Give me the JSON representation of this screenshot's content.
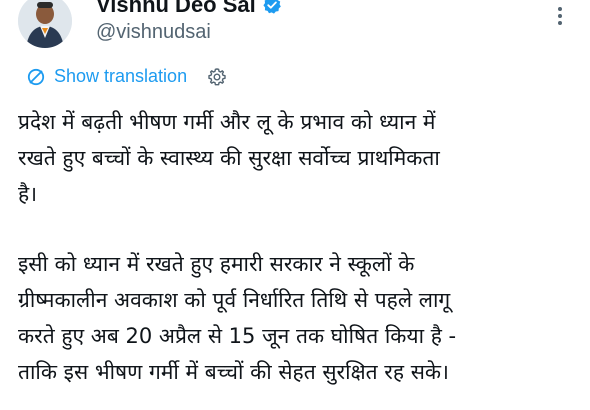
{
  "author": {
    "display_name": "Vishnu Deo Sai",
    "handle": "@vishnudsai",
    "verified": true,
    "avatar_icon": "profile-photo"
  },
  "actions": {
    "more_icon": "vertical-dots-icon"
  },
  "translation": {
    "link_label": "Show translation",
    "icon": "translate-icon",
    "settings_icon": "gear-icon"
  },
  "tweet": {
    "paragraph_1": "प्रदेश में बढ़ती भीषण गर्मी और लू के प्रभाव को ध्यान में\nरखते हुए बच्चों के स्वास्थ्य की सुरक्षा सर्वोच्च प्राथमिकता\nहै।",
    "paragraph_2": "इसी को ध्यान में रखते हुए हमारी सरकार ने स्कूलों के\nग्रीष्मकालीन अवकाश को पूर्व निर्धारित तिथि से पहले लागू\nकरते हुए अब 20 अप्रैल से 15 जून तक घोषित किया है -\nताकि इस भीषण गर्मी में बच्चों की सेहत सुरक्षित रह सके।"
  },
  "colors": {
    "link": "#1d9bf0",
    "secondary_text": "#536471",
    "primary_text": "#0f1419",
    "verified_badge": "#1d9bf0"
  }
}
